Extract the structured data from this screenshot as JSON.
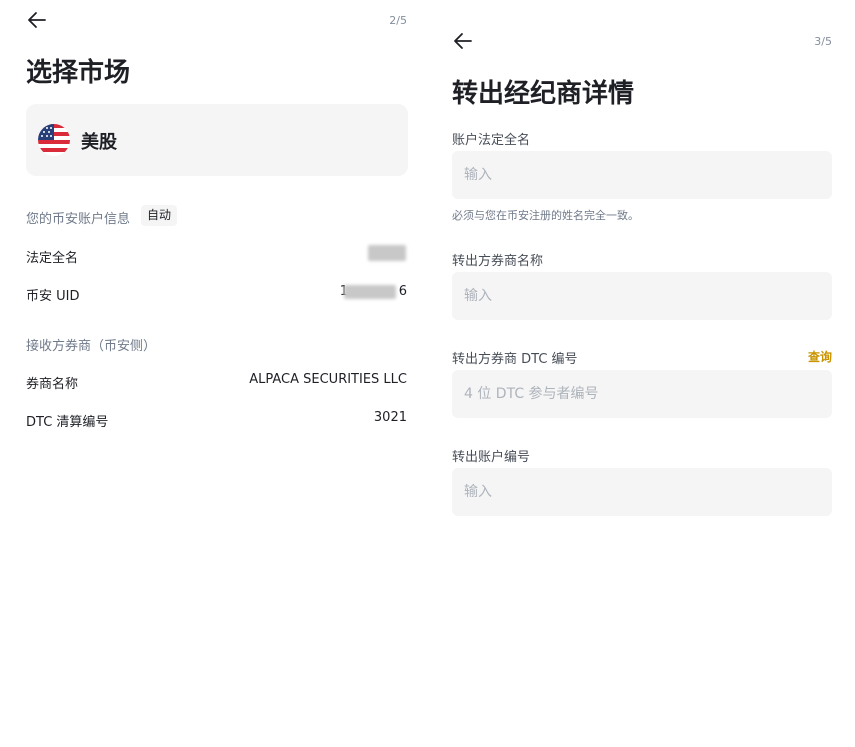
{
  "left": {
    "step": "2/5",
    "title": "选择市场",
    "market": {
      "name": "美股",
      "flag_icon": "us-flag-icon"
    },
    "account_section": {
      "label": "您的币安账户信息",
      "chip": "自动"
    },
    "rows": [
      {
        "label": "法定全名",
        "value": ""
      },
      {
        "label": "币安 UID",
        "value_prefix": "1",
        "value_suffix": "6"
      }
    ],
    "receiver_section": {
      "label": "接收方券商（币安侧）"
    },
    "broker_rows": [
      {
        "label": "券商名称",
        "value": "ALPACA SECURITIES LLC"
      },
      {
        "label": "DTC 清算编号",
        "value": "3021"
      }
    ]
  },
  "right": {
    "step": "3/5",
    "title": "转出经纪商详情",
    "fields": [
      {
        "label": "账户法定全名",
        "placeholder": "输入",
        "hint": "必须与您在币安注册的姓名完全一致。"
      },
      {
        "label": "转出方券商名称",
        "placeholder": "输入"
      },
      {
        "label": "转出方券商 DTC 编号",
        "placeholder": "4 位 DTC 参与者编号",
        "link": "查询"
      },
      {
        "label": "转出账户编号",
        "placeholder": "输入"
      }
    ]
  },
  "colors": {
    "text_primary": "#1e2026",
    "text_secondary": "#707a8a",
    "field_bg": "#f5f5f5",
    "accent_link": "#c99400"
  }
}
